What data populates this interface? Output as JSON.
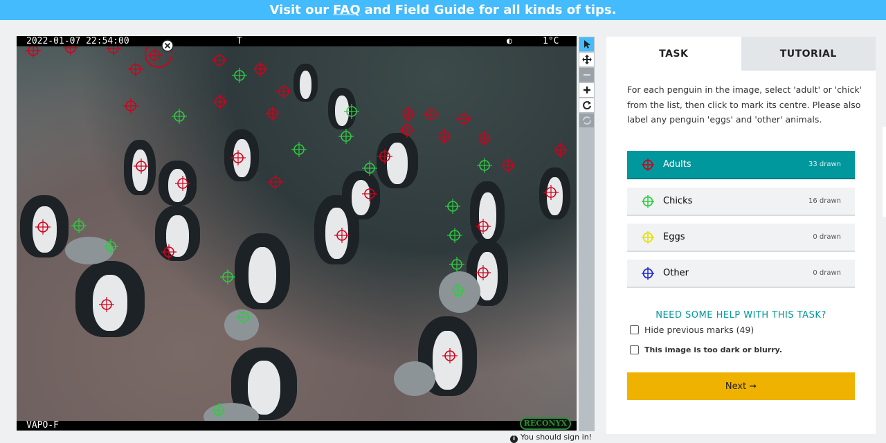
{
  "banner": {
    "prefix": "Visit our",
    "link": "FAQ",
    "suffix": "and Field Guide for all kinds of tips."
  },
  "camera_overlay": {
    "timestamp": "2022-01-07 22:54:00",
    "t_label": "T",
    "moon": "◐",
    "temperature": "1°C",
    "camera_id": "VAPO-F",
    "brand": "RECONYX"
  },
  "toolbar": {
    "icons": [
      "pointer-icon",
      "move-icon",
      "zoom-out-icon",
      "zoom-in-icon",
      "rotate-icon",
      "reset-icon"
    ]
  },
  "signin": {
    "text": "You should sign in!"
  },
  "tabs": {
    "task": "TASK",
    "tutorial": "TUTORIAL"
  },
  "task": {
    "instructions": "For each penguin in the image, select 'adult' or 'chick' from the list, then click to mark its centre. Please also label any penguin 'eggs' and 'other' animals.",
    "tools": [
      {
        "label": "Adults",
        "count": "33 drawn",
        "color": "#d0021b"
      },
      {
        "label": "Chicks",
        "count": "16 drawn",
        "color": "#2ecc40"
      },
      {
        "label": "Eggs",
        "count": "0 drawn",
        "color": "#f0e000"
      },
      {
        "label": "Other",
        "count": "0 drawn",
        "color": "#1f2bd6"
      }
    ],
    "help": "NEED SOME HELP WITH THIS TASK?",
    "hide_marks": "Hide previous marks (49)",
    "too_dark": "This image is too dark or blurry.",
    "next": "Next ➞"
  },
  "colors": {
    "banner": "#43bbfd",
    "active_tool": "#00979d",
    "next_button": "#f0b200"
  }
}
